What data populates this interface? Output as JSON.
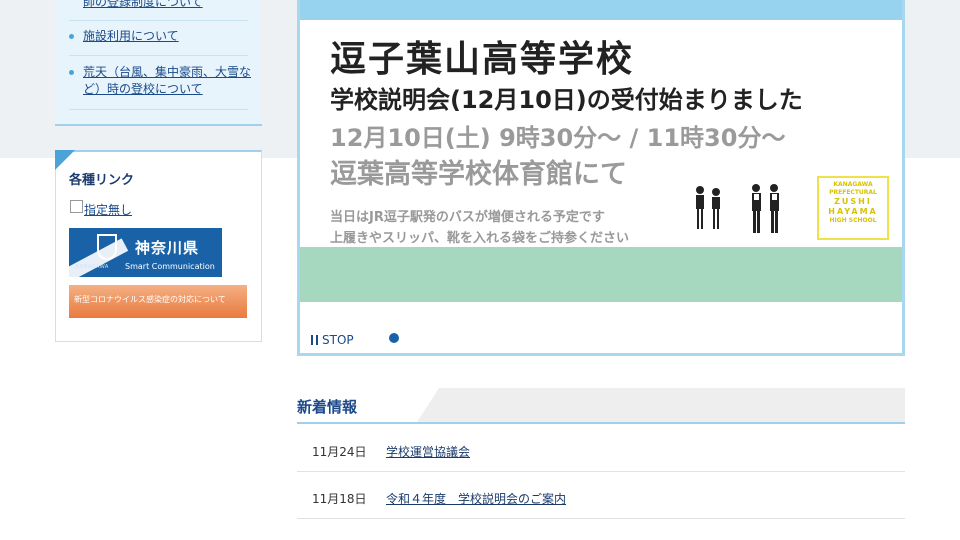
{
  "sidebar": {
    "menu_items": [
      {
        "label": "師の登録制度について"
      },
      {
        "label": "施設利用について"
      },
      {
        "label": "荒天（台風、集中豪雨、大雪など）時の登校について"
      }
    ],
    "links_title": "各種リンク",
    "checkbox_label": "指定無し",
    "kanagawa_banner": {
      "name": "神奈川県",
      "sub": "Smart Communication",
      "small": "KANAGAWA"
    },
    "corona_banner": "新型コロナウイルス感染症の対応について"
  },
  "slider": {
    "title": "逗子葉山高等学校",
    "line2": "学校説明会(12月10日)の受付始まりました",
    "line3": "12月10日(土) 9時30分～ / 11時30分～",
    "line4": "逗葉高等学校体育館にて",
    "note1": "当日はJR逗子駅発のバスが増便される予定です",
    "note2": "上履きやスリッパ、靴を入れる袋をご持参ください",
    "logo_lines": [
      "KANAGAWA",
      "PREFECTURAL",
      "ZUSHI",
      "HAYAMA",
      "HIGH SCHOOL"
    ],
    "stop_label": "STOP"
  },
  "news": {
    "title": "新着情報",
    "items": [
      {
        "date": "11月24日",
        "title": "学校運営協議会"
      },
      {
        "date": "11月18日",
        "title": "令和４年度　学校説明会のご案内"
      }
    ]
  }
}
